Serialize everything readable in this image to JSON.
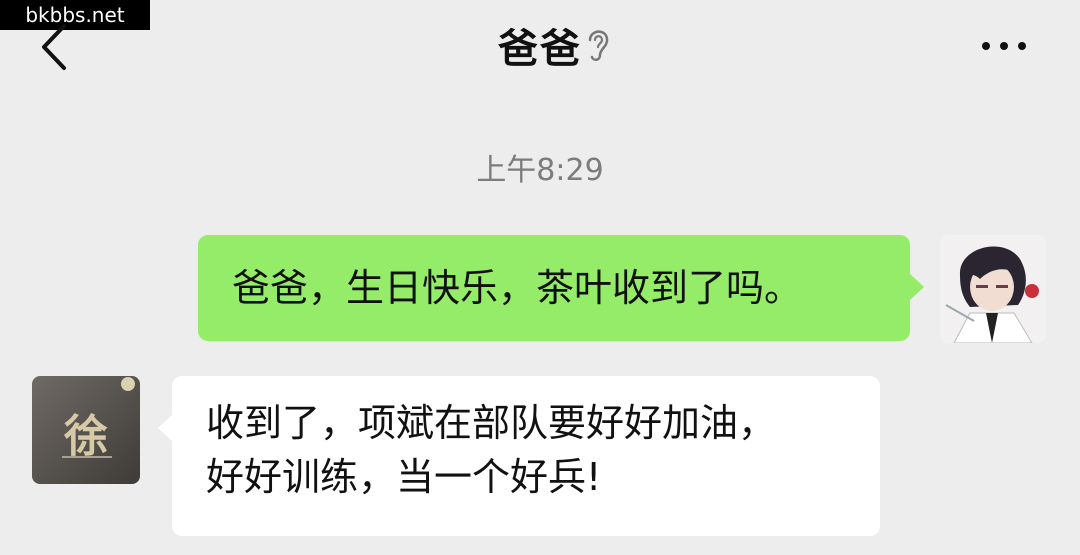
{
  "watermark": "bkbbs.net",
  "header": {
    "title": "爸爸",
    "back_icon": "chevron-left-icon",
    "voice_mode_icon": "ear-icon",
    "more_icon": "more-dots-icon"
  },
  "chat": {
    "timestamp": "上午8:29",
    "messages": [
      {
        "sender": "me",
        "text": "爸爸，生日快乐，茶叶收到了吗。"
      },
      {
        "sender": "dad",
        "lines": [
          "收到了，项斌在部队要好好加油，",
          "好好训练，当一个好兵!"
        ]
      }
    ],
    "dad_avatar_char": "徐"
  },
  "colors": {
    "background": "#ededed",
    "outgoing_bubble": "#95ec69",
    "incoming_bubble": "#ffffff"
  }
}
